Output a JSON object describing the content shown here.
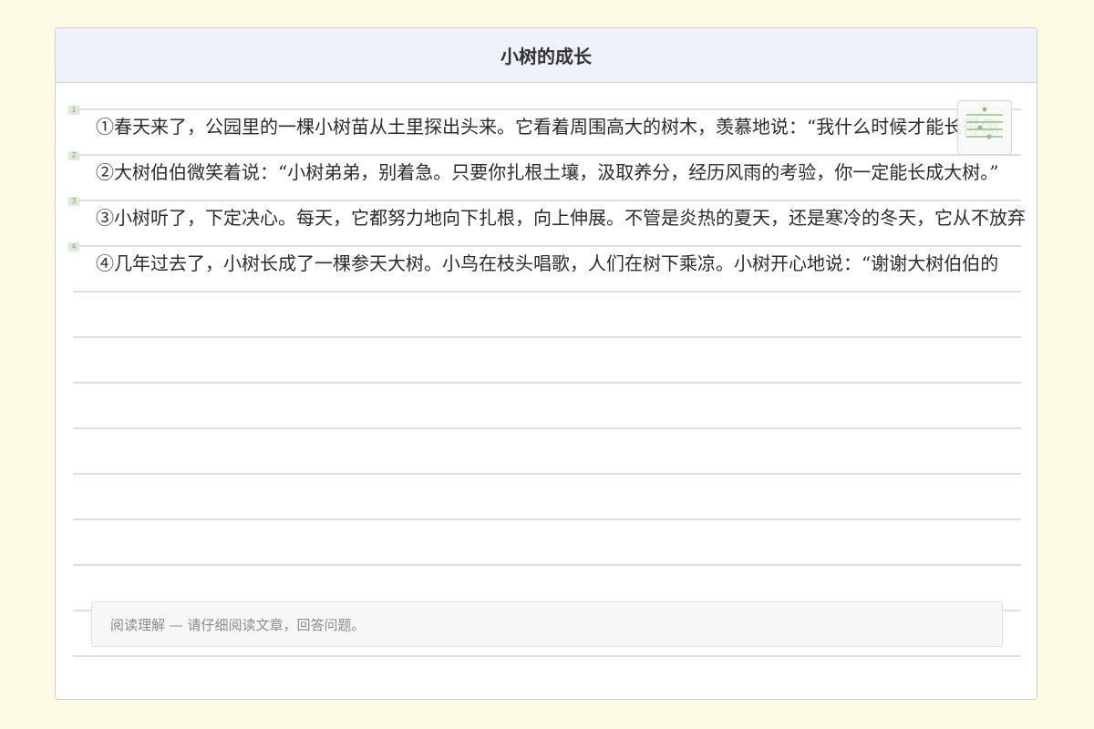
{
  "document": {
    "title": "小树的成长",
    "paragraphs": [
      {
        "number": "1",
        "text": "①春天来了，公园里的一棵小树苗从土里探出头来。它看着周围高大的树木，羡慕地说：“我什么时候才能长得像"
      },
      {
        "number": "2",
        "text": "②大树伯伯微笑着说：“小树弟弟，别着急。只要你扎根土壤，汲取养分，经历风雨的考验，你一定能长成大树。”"
      },
      {
        "number": "3",
        "text": "③小树听了，下定决心。每天，它都努力地向下扎根，向上伸展。不管是炎热的夏天，还是寒冷的冬天，它从不放弃"
      },
      {
        "number": "4",
        "text": "④几年过去了，小树长成了一棵参天大树。小鸟在枝头唱歌，人们在树下乘凉。小树开心地说：“谢谢大树伯伯的"
      }
    ],
    "floating_tool": {
      "icon": "divide-icon",
      "color": "#8fc081"
    },
    "instruction": "阅读理解 — 请仔细阅读文章，回答问题。"
  }
}
